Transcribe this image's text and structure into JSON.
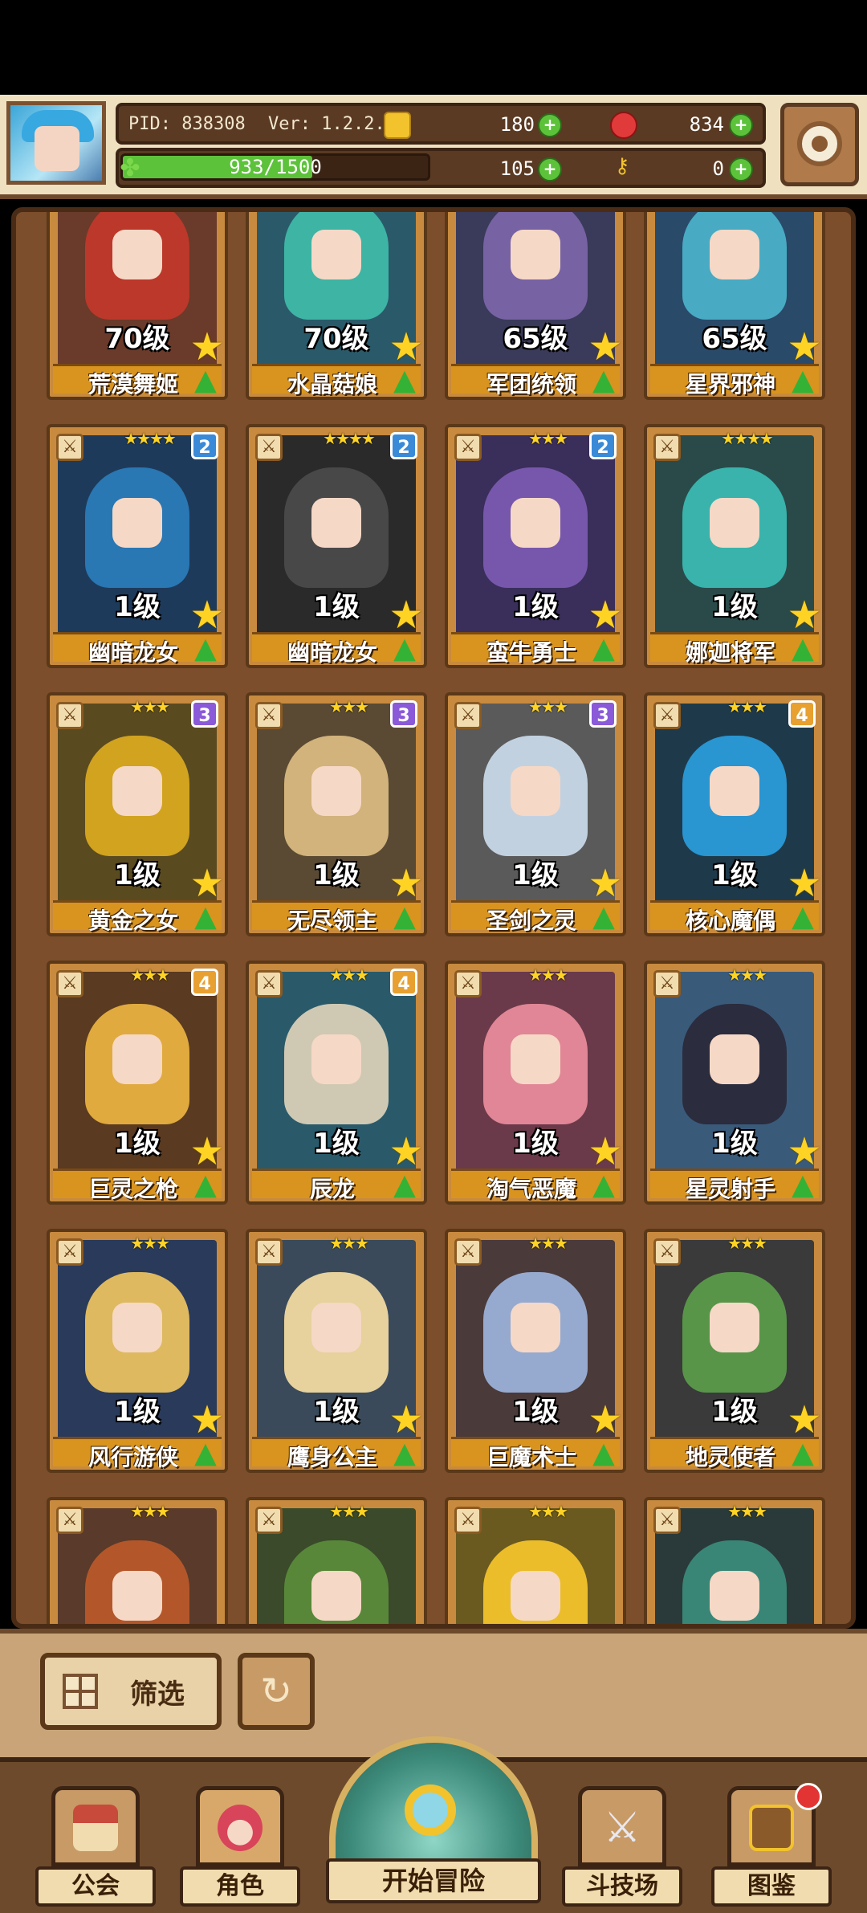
{
  "header": {
    "pid": "PID: 838308",
    "version": "Ver: 1.2.2.6",
    "gold": "180",
    "gems": "834",
    "energy_text": "933/1500",
    "energy_fraction": 0.622,
    "clovers": "105",
    "keys": "0"
  },
  "icons": {
    "gold": "gold-coin-icon",
    "gems": "red-gem-icon",
    "clover": "clover-icon",
    "key": "key-icon",
    "settings": "gear-icon"
  },
  "cards": [
    {
      "level": "70级",
      "name": "荒漠舞姬",
      "stars": "★★★",
      "badge": "",
      "color": "#c0382a",
      "bg": "#6a3a2a"
    },
    {
      "level": "70级",
      "name": "水晶菇娘",
      "stars": "★★★",
      "badge": "",
      "color": "#3fb9a8",
      "bg": "#2a5a6a"
    },
    {
      "level": "65级",
      "name": "军团统领",
      "stars": "★★★",
      "badge": "",
      "color": "#7a64a8",
      "bg": "#3a3a5a"
    },
    {
      "level": "65级",
      "name": "星界邪神",
      "stars": "★★★",
      "badge": "",
      "color": "#4ab0c8",
      "bg": "#2a4a6a"
    },
    {
      "level": "1级",
      "name": "幽暗龙女",
      "stars": "★★★★",
      "badge": "2",
      "color": "#2a7ab8",
      "bg": "#1e3a5a"
    },
    {
      "level": "1级",
      "name": "幽暗龙女",
      "stars": "★★★★",
      "badge": "2",
      "color": "#4a4a4a",
      "bg": "#2a2a2a"
    },
    {
      "level": "1级",
      "name": "蛮牛勇士",
      "stars": "★★★",
      "badge": "2",
      "color": "#7a5ab0",
      "bg": "#3a2e5a"
    },
    {
      "level": "1级",
      "name": "娜迦将军",
      "stars": "★★★★",
      "badge": "",
      "color": "#3ab8b0",
      "bg": "#2a4a4a"
    },
    {
      "level": "1级",
      "name": "黄金之女",
      "stars": "★★★",
      "badge": "3",
      "color": "#d8a820",
      "bg": "#5a4a20"
    },
    {
      "level": "1级",
      "name": "无尽领主",
      "stars": "★★★",
      "badge": "3",
      "color": "#d8b880",
      "bg": "#5a4a34"
    },
    {
      "level": "1级",
      "name": "圣剑之灵",
      "stars": "★★★",
      "badge": "3",
      "color": "#c8d8e8",
      "bg": "#5a5a5a"
    },
    {
      "level": "1级",
      "name": "核心魔偶",
      "stars": "★★★",
      "badge": "4",
      "color": "#2a9ad8",
      "bg": "#1e3a4a"
    },
    {
      "level": "1级",
      "name": "巨灵之枪",
      "stars": "★★★",
      "badge": "4",
      "color": "#e8b040",
      "bg": "#5a3a20"
    },
    {
      "level": "1级",
      "name": "辰龙",
      "stars": "★★★",
      "badge": "4",
      "color": "#d8d0b8",
      "bg": "#2a5a6a"
    },
    {
      "level": "1级",
      "name": "淘气恶魔",
      "stars": "★★★",
      "badge": "",
      "color": "#e88a9a",
      "bg": "#6a3a4a"
    },
    {
      "level": "1级",
      "name": "星灵射手",
      "stars": "★★★",
      "badge": "",
      "color": "#2a2a3a",
      "bg": "#3a5a7a"
    },
    {
      "level": "1级",
      "name": "风行游侠",
      "stars": "★★★",
      "badge": "",
      "color": "#e8c060",
      "bg": "#2a3a5a"
    },
    {
      "level": "1级",
      "name": "鹰身公主",
      "stars": "★★★",
      "badge": "",
      "color": "#f0d8a0",
      "bg": "#3a4a5a"
    },
    {
      "level": "1级",
      "name": "巨魔术士",
      "stars": "★★★",
      "badge": "",
      "color": "#9ab0d8",
      "bg": "#4a3a3a"
    },
    {
      "level": "1级",
      "name": "地灵使者",
      "stars": "★★★",
      "badge": "",
      "color": "#5a9a4a",
      "bg": "#3a3a3a"
    },
    {
      "level": "",
      "name": "",
      "stars": "★★★",
      "badge": "",
      "color": "#b8582a",
      "bg": "#5a3a2a"
    },
    {
      "level": "",
      "name": "",
      "stars": "★★★",
      "badge": "",
      "color": "#5a8a3a",
      "bg": "#3a4a2a"
    },
    {
      "level": "",
      "name": "",
      "stars": "★★★",
      "badge": "",
      "color": "#f2c32c",
      "bg": "#6a5a20"
    },
    {
      "level": "",
      "name": "",
      "stars": "★★★",
      "badge": "",
      "color": "#3a8a7a",
      "bg": "#2a3a3a"
    }
  ],
  "toolbar": {
    "filter_label": "筛选"
  },
  "nav": {
    "guild": "公会",
    "character": "角色",
    "start": "开始冒险",
    "arena": "斗技场",
    "codex": "图鉴"
  }
}
